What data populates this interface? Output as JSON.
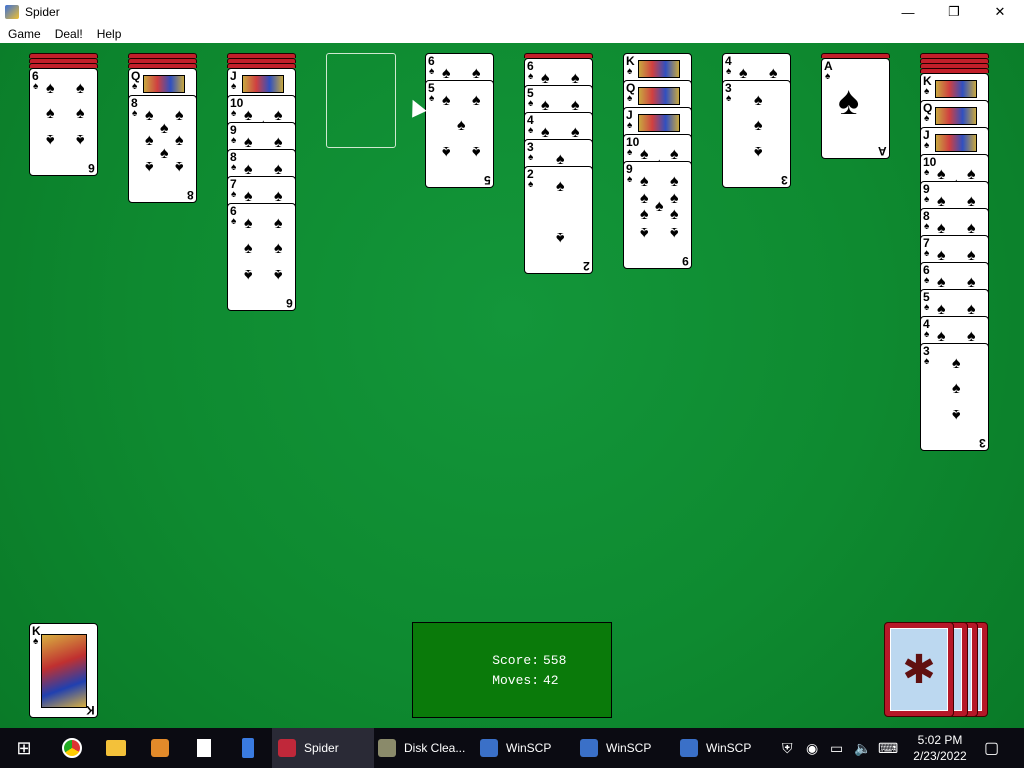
{
  "window": {
    "title": "Spider",
    "minimize": "—",
    "maximize": "❐",
    "close": "✕"
  },
  "menu": [
    "Game",
    "Deal!",
    "Help"
  ],
  "status": {
    "score_label": "Score:",
    "score": "558",
    "moves_label": "Moves:",
    "moves": "42"
  },
  "columns": [
    {
      "backs": 3,
      "cards": [
        "6"
      ]
    },
    {
      "backs": 3,
      "cards": [
        "Q",
        "8"
      ]
    },
    {
      "backs": 3,
      "cards": [
        "J",
        "10",
        "9",
        "8",
        "7",
        "6"
      ]
    },
    {
      "backs": 0,
      "cards": []
    },
    {
      "backs": 0,
      "cards": [
        "6",
        "5"
      ]
    },
    {
      "backs": 1,
      "cards": [
        "6",
        "5",
        "4",
        "3",
        "2"
      ]
    },
    {
      "backs": 0,
      "cards": [
        "K",
        "Q",
        "J",
        "10",
        "9"
      ]
    },
    {
      "backs": 0,
      "cards": [
        "4",
        "3"
      ]
    },
    {
      "backs": 1,
      "cards": [
        "A"
      ]
    },
    {
      "backs": 4,
      "cards": [
        "K",
        "Q",
        "J",
        "10",
        "9",
        "8",
        "7",
        "6",
        "5",
        "4",
        "3"
      ]
    }
  ],
  "completed_foundation": {
    "rank": "K"
  },
  "taskbar": {
    "items": [
      {
        "label": "Spider",
        "icon": "spider-icon",
        "active": true
      },
      {
        "label": "Disk Clea...",
        "icon": "disk-cleanup-icon",
        "active": false
      },
      {
        "label": "WinSCP",
        "icon": "winscp-icon",
        "active": false
      },
      {
        "label": "WinSCP",
        "icon": "winscp-icon",
        "active": false
      },
      {
        "label": "WinSCP",
        "icon": "winscp-icon",
        "active": false
      }
    ],
    "time": "5:02 PM",
    "date": "2/23/2022"
  },
  "colors": {
    "felt": "#0f8a2f",
    "card_back": "#c21f2a",
    "status_bg": "#0a7a0a"
  }
}
